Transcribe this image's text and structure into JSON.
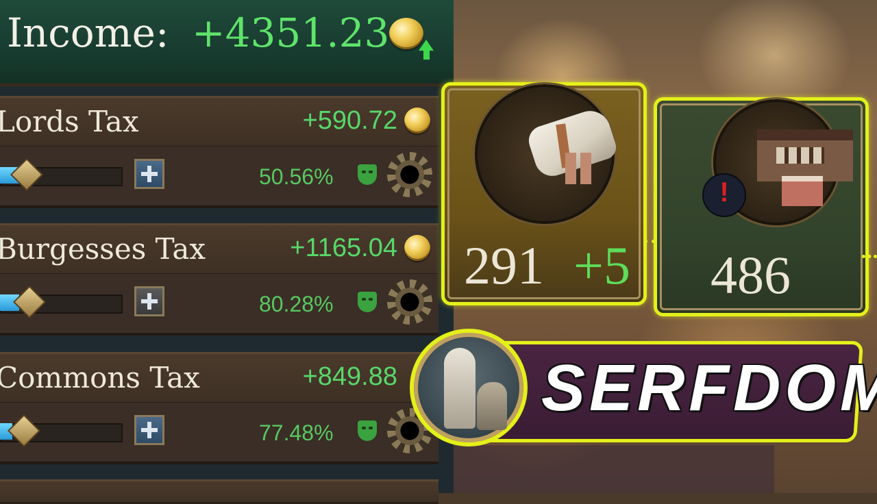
{
  "income": {
    "label": "Income:",
    "value": "+4351.23",
    "trend": "up",
    "coin_icon": "gold-coin-icon"
  },
  "taxes": [
    {
      "name": "Lords Tax",
      "value": "+590.72",
      "percent": "50.56%",
      "slider_level": 0.2,
      "plus_style": "blue"
    },
    {
      "name": "Burgesses Tax",
      "value": "+1165.04",
      "percent": "80.28%",
      "slider_level": 0.2,
      "plus_style": "grey"
    },
    {
      "name": "Commons Tax",
      "value": "+849.88",
      "percent": "77.48%",
      "slider_level": 0.15,
      "plus_style": "blue"
    }
  ],
  "resources": {
    "paper": {
      "icon": "paper-scroll-icon",
      "amount": "291",
      "bonus": "+5",
      "status_icon": "pause-icon"
    },
    "market": {
      "icon": "market-buildings-icon",
      "amount": "486",
      "alert": "!"
    }
  },
  "banner": {
    "text": "SERFDOM",
    "icon": "serf-kneeling-to-lord-icon"
  },
  "colors": {
    "highlight": "#e4f01a",
    "positive": "#5fdc5a",
    "income_header": "#1f4a3a"
  }
}
